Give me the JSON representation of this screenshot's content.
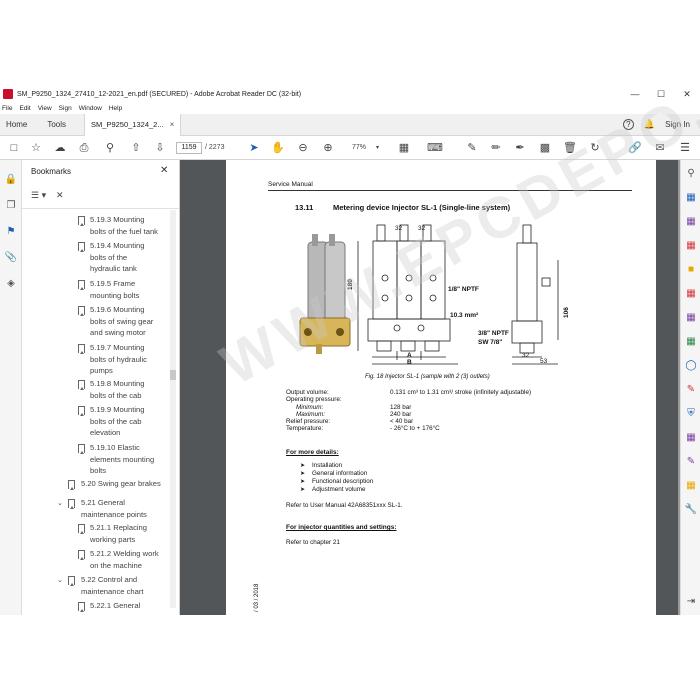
{
  "window": {
    "title": "SM_P9250_1324_27410_12-2021_en.pdf (SECURED) - Adobe Acrobat Reader DC (32-bit)",
    "min_label": "—",
    "max_label": "☐",
    "close_label": "✕"
  },
  "menu": [
    "File",
    "Edit",
    "View",
    "Sign",
    "Window",
    "Help"
  ],
  "tabs": {
    "home": "Home",
    "tools": "Tools",
    "doc": "SM_P9250_1324_2...",
    "doc_close": "×",
    "help": "?",
    "signin": "Sign In"
  },
  "toolbar": {
    "page_current": "1159",
    "page_total": "/ 2273",
    "zoom": "77%",
    "zoom_caret": "▾"
  },
  "bookmarks": {
    "header": "Bookmarks",
    "close": "✕",
    "options": "☰ ▾",
    "delete": "✕",
    "items": [
      [
        "5.19.3 Mounting",
        "bolts of the fuel tank"
      ],
      [
        "5.19.4 Mounting",
        "bolts of the",
        "hydraulic tank"
      ],
      [
        "5.19.5 Frame",
        "mounting bolts"
      ],
      [
        "5.19.6 Mounting",
        "bolts of swing gear",
        "and swing motor"
      ],
      [
        "5.19.7 Mounting",
        "bolts of hydraulic",
        "pumps"
      ],
      [
        "5.19.8 Mounting",
        "bolts of the cab"
      ],
      [
        "5.19.9 Mounting",
        "bolts of the cab",
        "elevation"
      ],
      [
        "5.19.10 Elastic",
        "elements mounting",
        "bolts"
      ],
      [
        "5.20 Swing gear brakes"
      ],
      [
        "5.21 General",
        "maintenance points"
      ],
      [
        "5.21.1 Replacing",
        "working parts"
      ],
      [
        "5.21.2 Welding work",
        "on the machine"
      ],
      [
        "5.22 Control and",
        "maintenance chart"
      ],
      [
        "5.22.1 General"
      ]
    ]
  },
  "page": {
    "header": "Service Manual",
    "section_num": "13.11",
    "section_title": "Metering device Injector SL-1 (Single-line system)",
    "dims": {
      "d32a": "32",
      "d32b": "32",
      "npt18": "1/8\" NPTF",
      "mm103": "10.3 mm²",
      "d180": "180",
      "dA": "A",
      "dB": "B",
      "npt38": "3/8\" NPTF",
      "sw78": "SW 7/8\"",
      "d106": "106",
      "d32c": "32",
      "d53": "53"
    },
    "caption": "Fig. 18  Injector SL-1 (sample with 2 (3) outlets)",
    "specs": [
      {
        "label": "Output volume:",
        "value": "0.131 cm³ to 1.31 cm³/ stroke (infinitely adjustable)"
      },
      {
        "label": "Operating pressure:",
        "value": ""
      },
      {
        "label": "Minimum:",
        "value": "128 bar"
      },
      {
        "label": "Maximum:",
        "value": "240 bar"
      },
      {
        "label": "Relief pressure:",
        "value": "< 40 bar"
      },
      {
        "label": "Temperature:",
        "value": "- 26°C to + 176°C"
      }
    ],
    "more_heading": "For more details:",
    "more_items": [
      "Installation",
      "General information",
      "Functional description",
      "Adjustment volume"
    ],
    "refer_manual": "Refer to User Manual 42A68351xxx SL-1.",
    "qty_heading": "For injector quantities and settings:",
    "refer_chapter": "Refer to chapter 21",
    "footer_date": "/ 03 / 2018",
    "watermark": "WWW.EPCDEPO.COM"
  }
}
